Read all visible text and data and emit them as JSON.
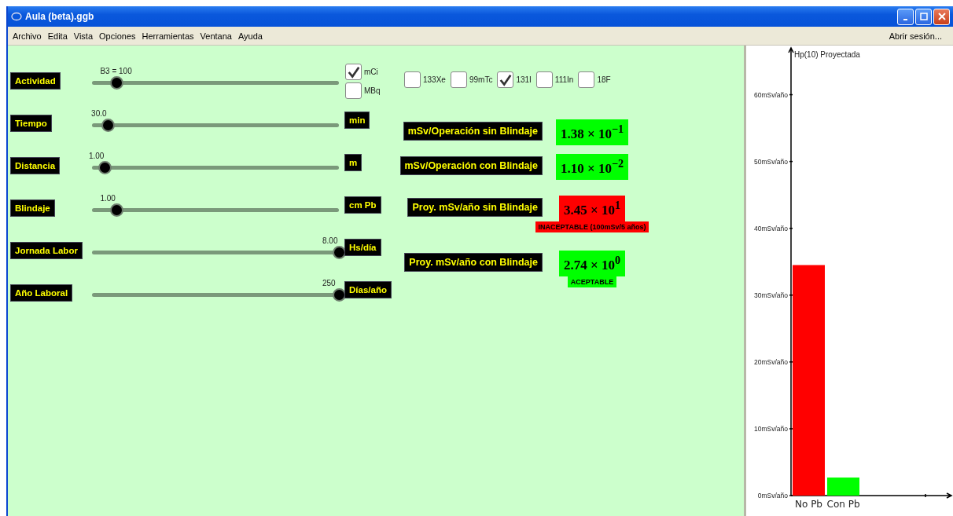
{
  "window": {
    "title": "Aula (beta).ggb"
  },
  "menu": [
    "Archivo",
    "Edita",
    "Vista",
    "Opciones",
    "Herramientas",
    "Ventana",
    "Ayuda"
  ],
  "session_link": "Abrir sesión...",
  "sliders": [
    {
      "label": "Actividad",
      "value": "B3 = 100",
      "level": 0.1
    },
    {
      "label": "Tiempo",
      "value": "30.0",
      "level": 0.064,
      "unit": "min"
    },
    {
      "label": "Distancia",
      "value": "1.00",
      "level": 0.054,
      "unit": "m"
    },
    {
      "label": "Blindaje",
      "value": "1.00",
      "level": 0.1,
      "unit": "cm Pb"
    },
    {
      "label": "Jornada Labor",
      "value": "8.00",
      "level": 1.0,
      "unit": "Hs/día"
    },
    {
      "label": "Año Laboral",
      "value": "250",
      "level": 1.0,
      "unit": "Días/año"
    }
  ],
  "activity_units": [
    {
      "label": "mCi",
      "checked": true
    },
    {
      "label": "MBq",
      "checked": false
    }
  ],
  "isotopes": [
    {
      "label": "133Xe",
      "checked": false
    },
    {
      "label": "99mTc",
      "checked": false
    },
    {
      "label": "131I",
      "checked": true
    },
    {
      "label": "111In",
      "checked": false
    },
    {
      "label": "18F",
      "checked": false
    }
  ],
  "results": [
    {
      "label": "mSv/Operación sin Blindaje",
      "value": "1.38 × 10$^{−1}$",
      "color": "#00ff00"
    },
    {
      "label": "mSv/Operación con Blindaje",
      "value": "1.10 × 10$^{−2}$",
      "color": "#00ff00"
    },
    {
      "label": "Proy. mSv/año sin Blindaje",
      "value": "3.45 × 10$^{1}$",
      "color": "#ff0000",
      "status": "INACEPTABLE (100mSv/5 años)"
    },
    {
      "label": "Proy. mSv/año con Blindaje",
      "value": "2.74 × 10$^{0}$",
      "color": "#00ff00",
      "status": "ACEPTABLE"
    }
  ],
  "graph": {
    "chart_data": {
      "type": "bar",
      "ylabel": "Hp(10) Proyectada",
      "categories": [
        "No Pb",
        "Con Pb"
      ],
      "stacked": true,
      "ylim": [
        0,
        67
      ],
      "series": [
        {
          "color": "#ff0000",
          "values": [
            34.5,
            null
          ]
        },
        {
          "color": "#00ff00",
          "values": [
            null,
            2.7
          ]
        }
      ],
      "yticks": [
        {
          "value": 0,
          "label": "0mSv/año"
        },
        {
          "value": 10,
          "label": "10mSv/año"
        },
        {
          "value": 20,
          "label": "20mSv/año"
        },
        {
          "value": 30,
          "label": "30mSv/año"
        },
        {
          "value": 40,
          "label": "40mSv/año"
        },
        {
          "value": 50,
          "label": "50mSv/año"
        },
        {
          "value": 60,
          "label": "60mSv/año"
        }
      ]
    }
  }
}
